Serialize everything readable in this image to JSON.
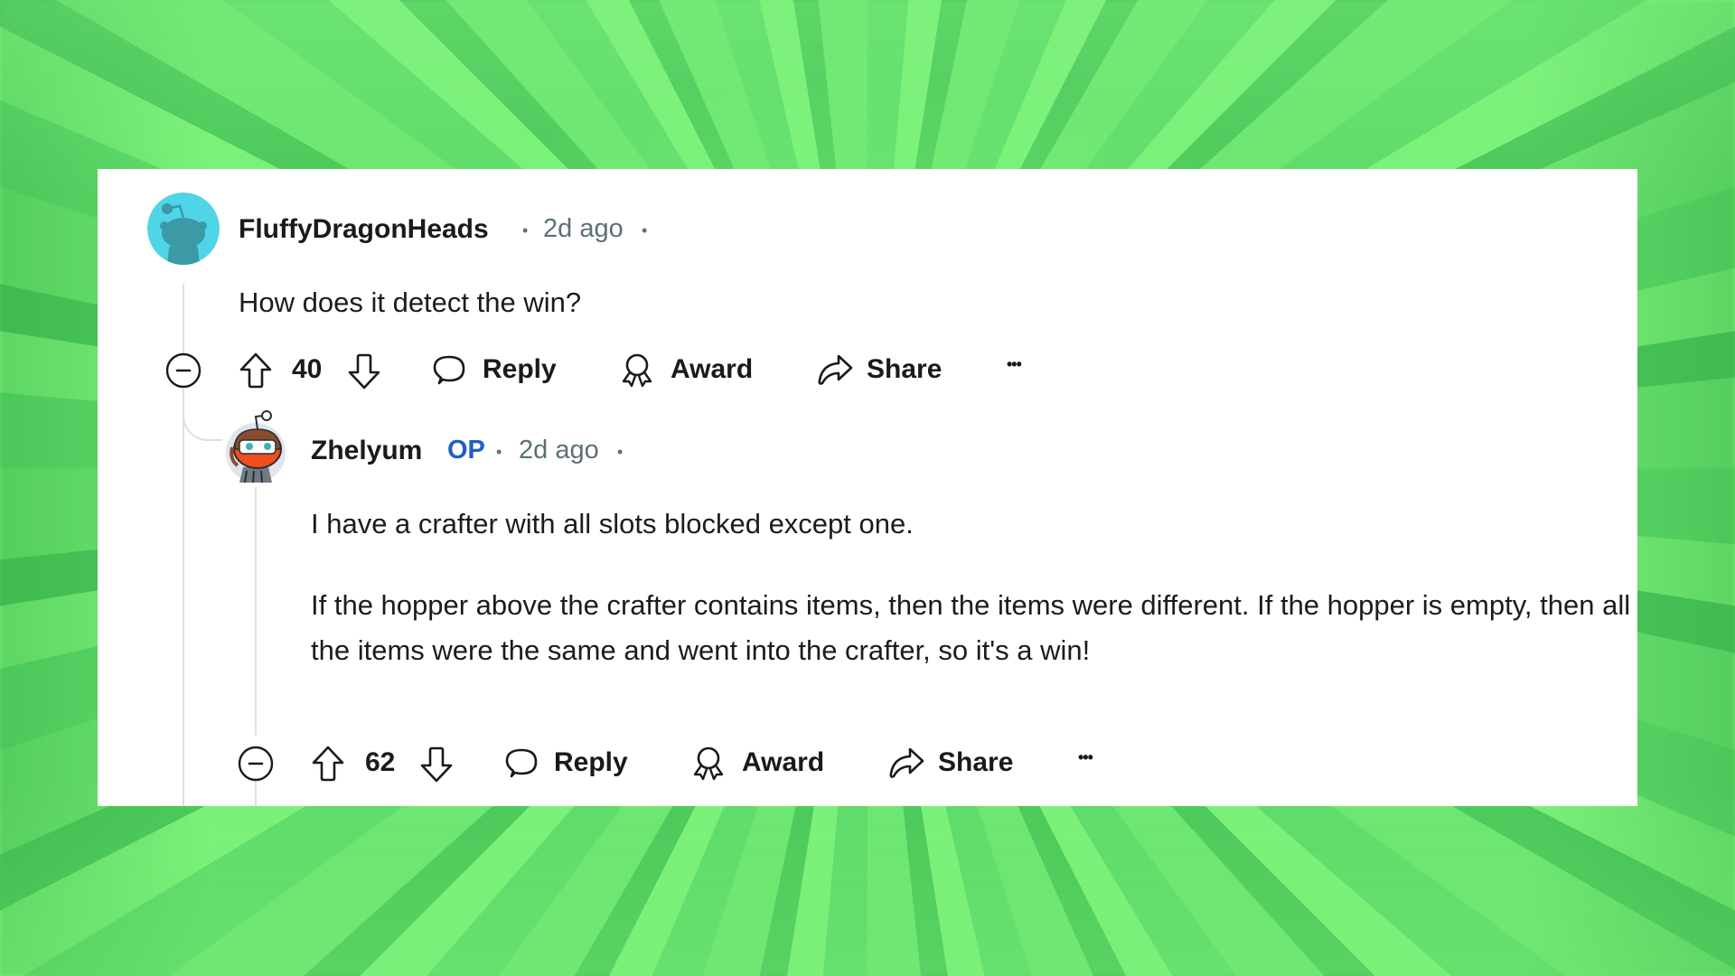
{
  "comments": [
    {
      "username": "FluffyDragonHeads",
      "timestamp": "2d ago",
      "separator": "•",
      "body": [
        "How does it detect the win?"
      ],
      "score": "40",
      "actions": {
        "reply": "Reply",
        "award": "Award",
        "share": "Share",
        "more": "•••"
      },
      "avatar_color": "#50d4e8"
    },
    {
      "username": "Zhelyum",
      "op_badge": "OP",
      "timestamp": "2d ago",
      "separator": "•",
      "body": [
        "I have a crafter with all slots blocked except one.",
        "If the hopper above the crafter contains items, then the items were different. If the hopper is empty, then all the items were the same and went into the crafter, so it's a win!"
      ],
      "score": "62",
      "actions": {
        "reply": "Reply",
        "award": "Award",
        "share": "Share",
        "more": "•••"
      },
      "op_color": "#1d5fc4"
    }
  ]
}
